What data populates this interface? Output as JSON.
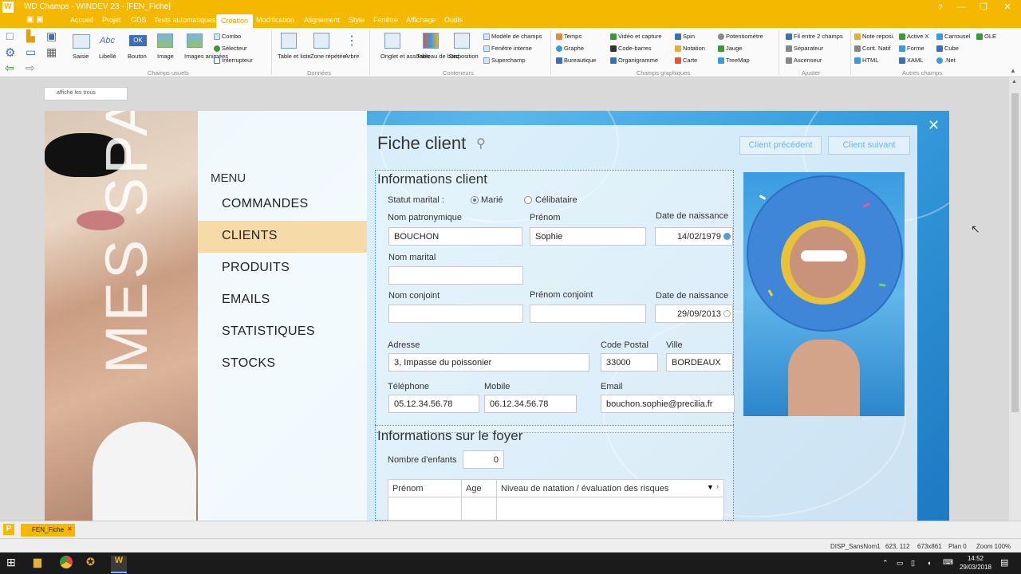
{
  "window": {
    "title": "WD Champs - WINDEV 23 - [FEN_Fiche]",
    "logo": "W"
  },
  "menubar": {
    "items": [
      "Accueil",
      "Projet",
      "GDS",
      "Tests automatiques",
      "Création",
      "Modification",
      "Alignement",
      "Style",
      "Fenêtre",
      "Affichage",
      "Outils"
    ],
    "active": "Création"
  },
  "ribbon": {
    "large_buttons": [
      "Saisie",
      "Libellé",
      "Bouton",
      "Image",
      "Images animées",
      "Table et liste",
      "Zone répétée",
      "Arbre",
      "Onglet et associés",
      "Tableau de bord",
      "Disposition"
    ],
    "combo_group": [
      "Combo",
      "Sélecteur",
      "Interrupteur"
    ],
    "containers": [
      "Modèle de champs",
      "Fenêtre interne",
      "Superchamp"
    ],
    "graphics": [
      "Temps",
      "Graphe",
      "Bureautique",
      "Vidéo et capture",
      "Code-barres",
      "Organigramme",
      "Spin",
      "Notation",
      "Carte",
      "Potentiomètre",
      "Jauge",
      "TreeMap"
    ],
    "adjust": [
      "Fil entre 2 champs",
      "Séparateur",
      "Ascenseur"
    ],
    "others": [
      "Note reposi.",
      "Cont. Natif",
      "HTML",
      "Active X",
      "Forme",
      "XAML",
      "Carrousel",
      "Cube",
      ".Net",
      "OLE"
    ],
    "groups": [
      "Champs usuels",
      "Données",
      "Conteneurs",
      "Champs graphiques",
      "Ajuster",
      "Autres champs"
    ],
    "abc": "Abc",
    "ok": "OK"
  },
  "editor": {
    "note": "affiche les trous"
  },
  "app": {
    "spa_text": "MES SPA",
    "menu_title": "MENU",
    "menu": [
      "COMMANDES",
      "CLIENTS",
      "PRODUITS",
      "EMAILS",
      "STATISTIQUES",
      "STOCKS"
    ],
    "selected_menu": "CLIENTS",
    "form_title": "Fiche client",
    "prev_button": "Client précédent",
    "next_button": "Client suivant",
    "section_info": "Informations client",
    "statut_label": "Statut marital :",
    "statut_options": [
      "Marié",
      "Célibataire"
    ],
    "statut_selected": "Marié",
    "labels": {
      "nom": "Nom patronymique",
      "prenom": "Prénom",
      "naissance": "Date de naissance",
      "nom_marital": "Nom marital",
      "nom_conjoint": "Nom conjoint",
      "prenom_conjoint": "Prénom conjoint",
      "naissance_conjoint": "Date de naissance",
      "adresse": "Adresse",
      "cp": "Code Postal",
      "ville": "Ville",
      "tel": "Téléphone",
      "mobile": "Mobile",
      "email": "Email"
    },
    "values": {
      "nom": "BOUCHON",
      "prenom": "Sophie",
      "naissance": "14/02/1979",
      "nom_marital": "",
      "nom_conjoint": "",
      "prenom_conjoint": "",
      "naissance_conjoint": "29/09/2013",
      "adresse": "3, Impasse du poissonier",
      "cp": "33000",
      "ville": "BORDEAUX",
      "tel": "05.12.34.56.78",
      "mobile": "06.12.34.56.78",
      "email": "bouchon.sophie@precilia.fr"
    },
    "section_foyer": "Informations sur le foyer",
    "enfants_label": "Nombre d'enfants",
    "enfants_value": "0",
    "table_headers": [
      "Prénom",
      "Age",
      "Niveau de natation / évaluation des risques"
    ]
  },
  "tabs": {
    "open_tab": "FEN_Fiche"
  },
  "status": {
    "items": [
      "DISP_SansNom1",
      "623, 112",
      "673x861",
      "Plan 0",
      "Zoom 100%"
    ]
  },
  "taskbar": {
    "time": "14:52",
    "date": "29/03/2018"
  }
}
